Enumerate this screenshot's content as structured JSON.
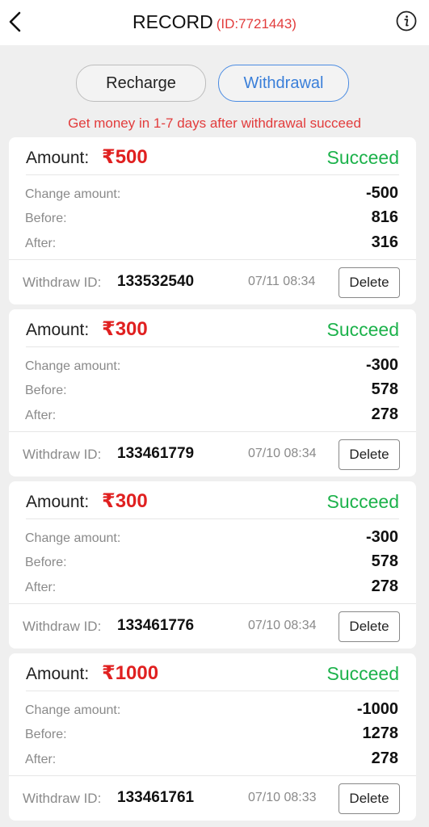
{
  "header": {
    "title": "RECORD",
    "user_id": "(ID:7721443)",
    "back_icon": "chevron-left-icon",
    "info_icon": "info-icon"
  },
  "tabs": [
    {
      "label": "Recharge",
      "active": false
    },
    {
      "label": "Withdrawal",
      "active": true
    }
  ],
  "notice": "Get money in 1-7 days after withdrawal succeed",
  "labels": {
    "amount": "Amount:",
    "change_amount": "Change amount:",
    "before": "Before:",
    "after": "After:",
    "withdraw_id": "Withdraw ID:",
    "delete": "Delete"
  },
  "records": [
    {
      "amount": "₹500",
      "status": "Succeed",
      "change": "-500",
      "before": "816",
      "after": "316",
      "withdraw_id": "133532540",
      "time": "07/11 08:34"
    },
    {
      "amount": "₹300",
      "status": "Succeed",
      "change": "-300",
      "before": "578",
      "after": "278",
      "withdraw_id": "133461779",
      "time": "07/10 08:34"
    },
    {
      "amount": "₹300",
      "status": "Succeed",
      "change": "-300",
      "before": "578",
      "after": "278",
      "withdraw_id": "133461776",
      "time": "07/10 08:34"
    },
    {
      "amount": "₹1000",
      "status": "Succeed",
      "change": "-1000",
      "before": "1278",
      "after": "278",
      "withdraw_id": "133461761",
      "time": "07/10 08:33"
    }
  ],
  "colors": {
    "accent_red": "#e02020",
    "success_green": "#1cb24b",
    "active_tab_blue": "#3a7fd9"
  }
}
